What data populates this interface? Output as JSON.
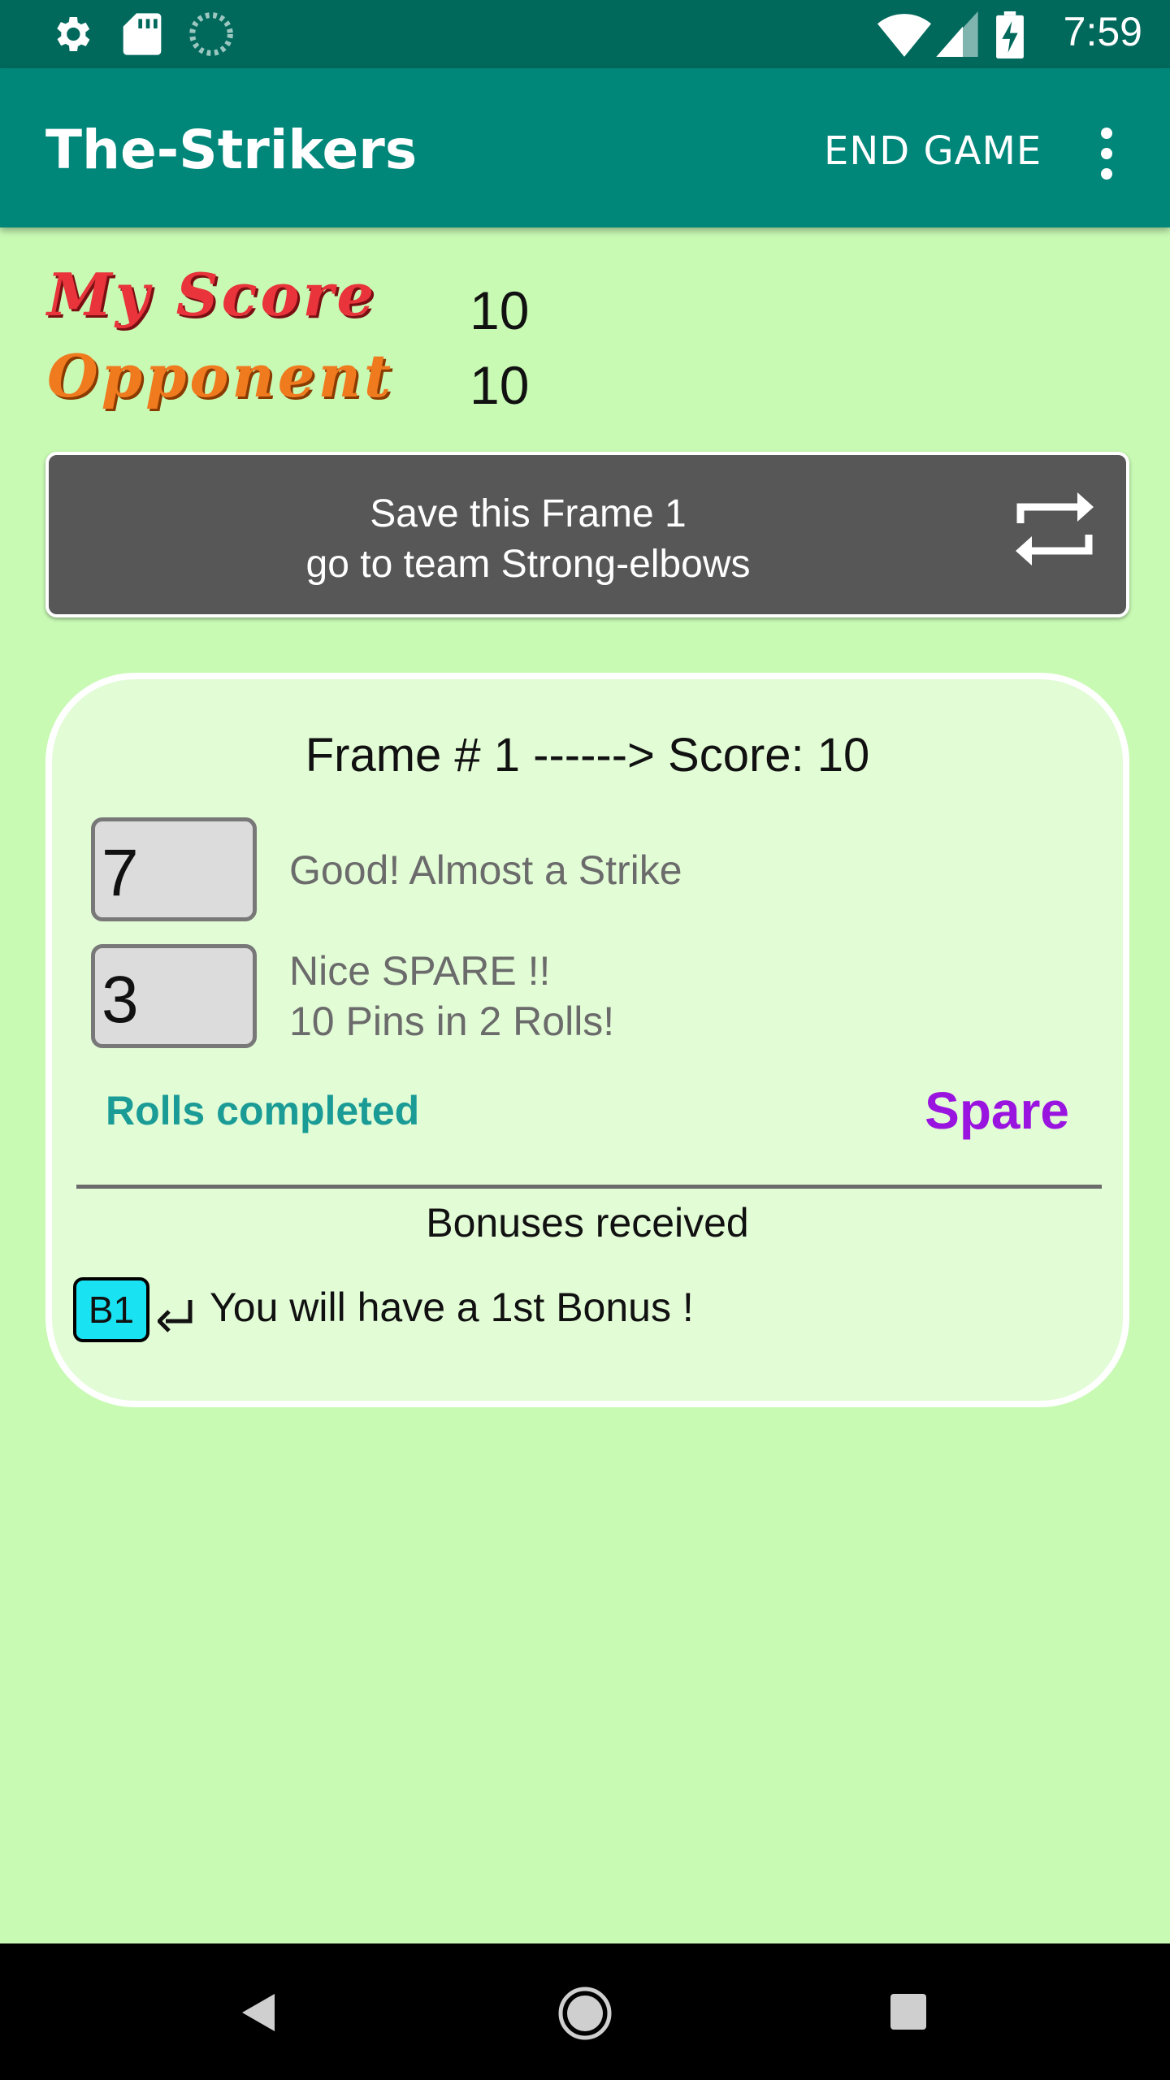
{
  "status_bar": {
    "time": "7:59",
    "icons": [
      "settings-icon",
      "sd-card-icon",
      "sync-icon",
      "wifi-icon",
      "signal-icon",
      "battery-charging-icon"
    ]
  },
  "app_bar": {
    "title": "The-Strikers",
    "end_game_label": "END GAME",
    "more_icon": "more-vert-icon"
  },
  "scores": {
    "my_score_label": "My Score",
    "my_score_value": "10",
    "opponent_label": "Opponent",
    "opponent_value": "10"
  },
  "save_button": {
    "line1": "Save this Frame 1",
    "line2": "go to team Strong-elbows",
    "icon": "swap-icon"
  },
  "frame": {
    "title": "Frame # 1 ------> Score: 10",
    "roll1": {
      "value": "7",
      "message": "Good! Almost a Strike"
    },
    "roll2": {
      "value": "3",
      "message_line1": "Nice SPARE !!",
      "message_line2": "10 Pins in 2 Rolls!"
    },
    "status": "Rolls completed",
    "result": "Spare",
    "bonuses_heading": "Bonuses received",
    "bonus_badge": "B1",
    "bonus_message": "You will have a 1st Bonus !"
  },
  "colors": {
    "status_bar": "#00695c",
    "app_bar": "#00877a",
    "background": "#c8fab4",
    "card": "#e2fcd6",
    "my_score": "#e8343a",
    "opponent": "#f07a1e",
    "rolls_completed": "#1a9b96",
    "spare": "#9a14e0",
    "bonus_badge": "#19e2f2"
  },
  "nav_bar": {
    "back_icon": "back-icon",
    "home_icon": "home-icon",
    "recents_icon": "recents-icon"
  }
}
